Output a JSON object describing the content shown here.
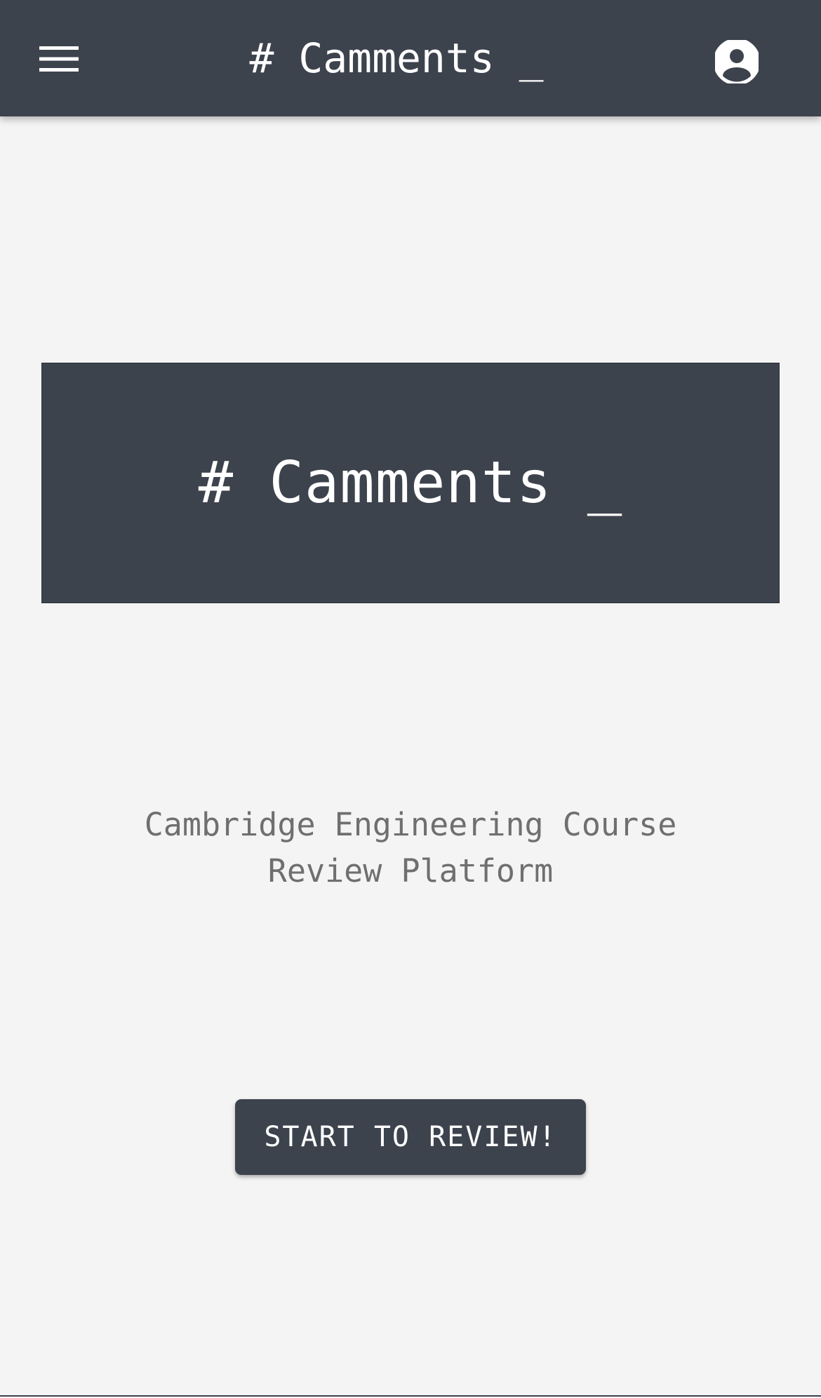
{
  "topbar": {
    "title": "# Camments _",
    "menu_icon": "hamburger-menu-icon",
    "account_icon": "account-circle-icon"
  },
  "hero": {
    "title": "# Camments _"
  },
  "tagline": {
    "text": "Cambridge Engineering Course Review Platform"
  },
  "cta": {
    "label": "START TO REVIEW!"
  },
  "colors": {
    "primary": "#3d434d",
    "background": "#f4f4f4",
    "text_on_primary": "#ffffff",
    "muted_text": "#6f6f6f"
  }
}
